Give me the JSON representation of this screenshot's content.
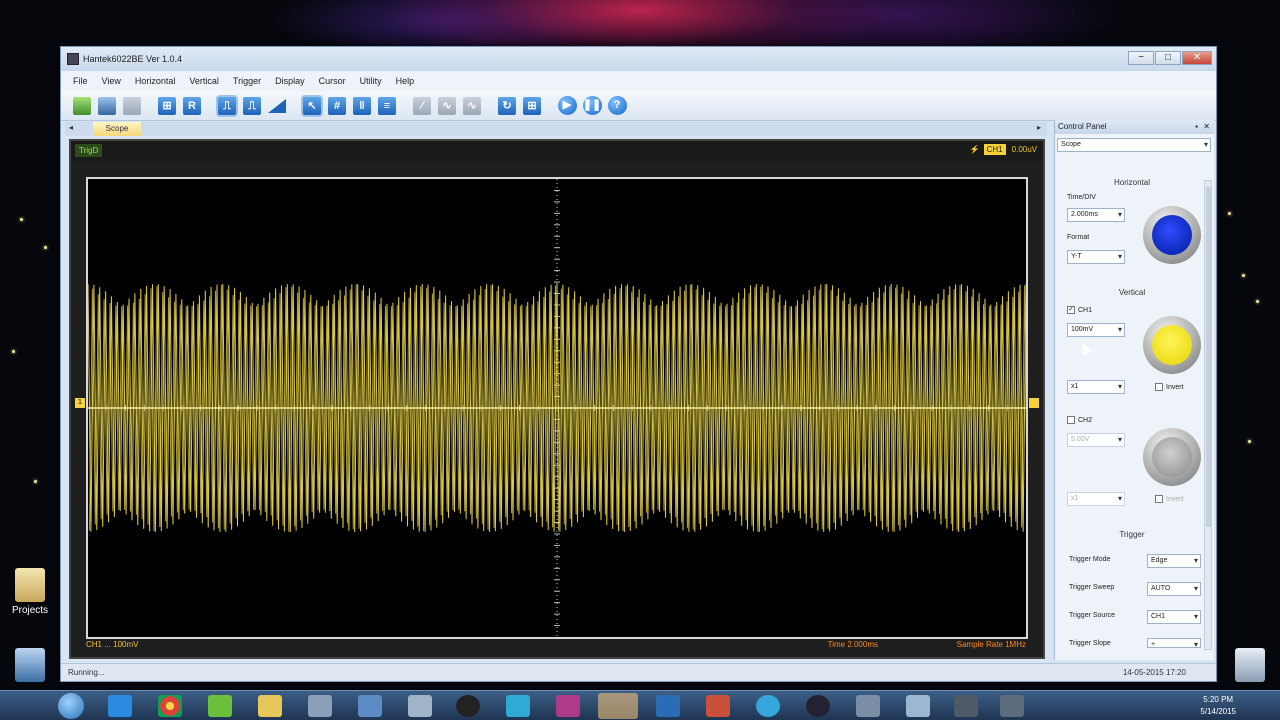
{
  "window": {
    "title": "Hantek6022BE Ver 1.0.4",
    "buttons": {
      "minimize": "−",
      "maximize": "□",
      "close": "✕"
    }
  },
  "menu": [
    "File",
    "View",
    "Horizontal",
    "Vertical",
    "Trigger",
    "Display",
    "Cursor",
    "Utility",
    "Help"
  ],
  "toolbar": {
    "icons": [
      "open-icon",
      "save-icon",
      "print-icon",
      "auto-set-icon",
      "run-stop-R-icon",
      "rising-edge-icon",
      "falling-edge-icon",
      "ramp-icon",
      "cursor-select-icon",
      "cursor-cross-icon",
      "cursor-vertical-icon",
      "cursor-horizontal-icon",
      "math-icon",
      "ref-icon",
      "fft-icon",
      "refresh-icon",
      "grid-icon",
      "play-icon",
      "pause-icon",
      "help-icon"
    ],
    "r_label": "R",
    "help_label": "?"
  },
  "document": {
    "tab_label": "Scope",
    "left_arrow": "◂",
    "right_arrow": "▸"
  },
  "scope": {
    "trig_status": "TrigD",
    "trig_channel": "CH1",
    "trig_level": "0.00uV",
    "ch_marker": "1",
    "footer_channel": "CH1 ...     100mV",
    "footer_time": "Time  2.000ms",
    "footer_rate": "Sample Rate  1MHz",
    "trace_color": "#e8d44a"
  },
  "control_panel": {
    "title": "Control Panel",
    "mode": "Scope",
    "horizontal": {
      "title": "Horizontal",
      "time_div_label": "Time/DIV",
      "time_div_value": "2.000ms",
      "format_label": "Format",
      "format_value": "Y-T"
    },
    "vertical": {
      "title": "Vertical",
      "ch1_label": "CH1",
      "ch1_checked": true,
      "ch1_volts": "100mV",
      "ch1_probe": "x1",
      "ch1_invert_label": "Invert",
      "ch2_label": "CH2",
      "ch2_checked": false,
      "ch2_volts": "5.00V",
      "ch2_probe": "x1",
      "ch2_invert_label": "Invert"
    },
    "trigger": {
      "title": "Trigger",
      "mode_label": "Trigger Mode",
      "mode_value": "Edge",
      "sweep_label": "Trigger Sweep",
      "sweep_value": "AUTO",
      "source_label": "Trigger Source",
      "source_value": "CH1",
      "slope_label": "Trigger Slope",
      "slope_value": "+"
    }
  },
  "status": {
    "left": "Running...",
    "right": "14-05-2015  17:20"
  },
  "desktop": {
    "projects_label": "Projects"
  },
  "taskbar": {
    "time": "5:20 PM",
    "date": "5/14/2015"
  }
}
